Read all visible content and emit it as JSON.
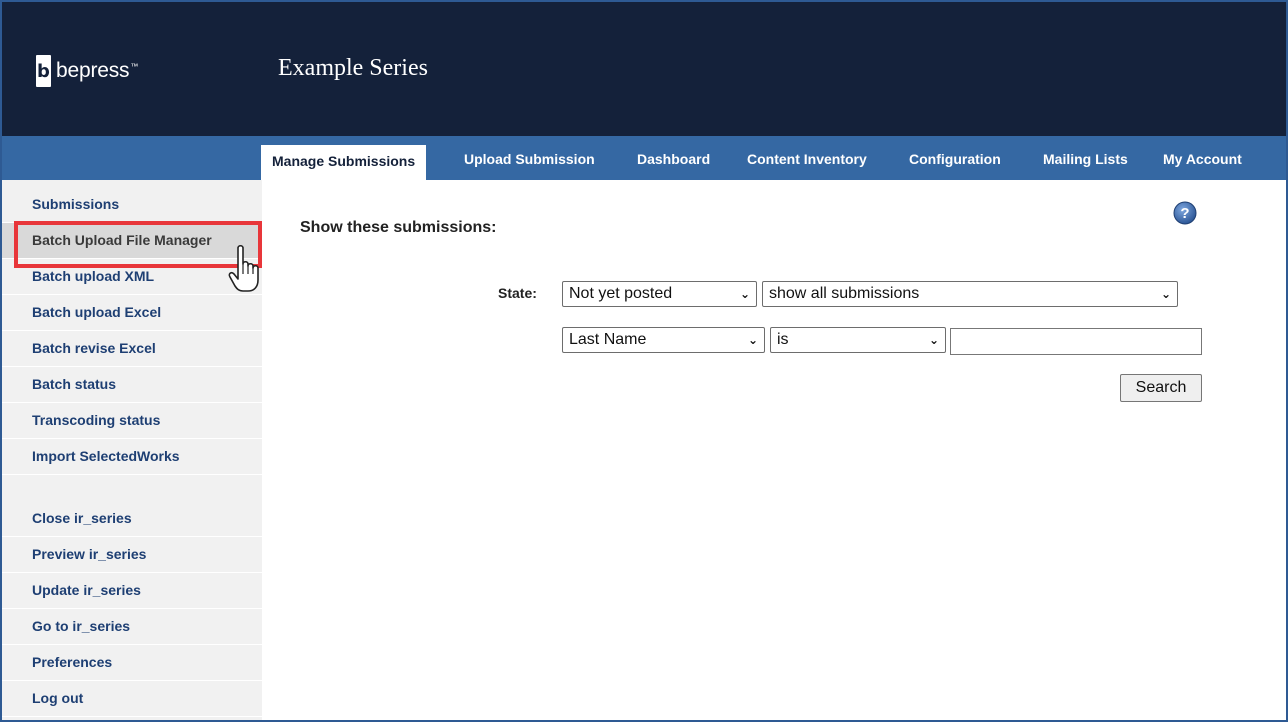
{
  "header": {
    "logo_text": "bepress",
    "logo_tm": "™",
    "logo_glyph": "b",
    "site_title": "Example Series",
    "colors": {
      "header_bg": "#14213a",
      "nav_bg": "#3568a3",
      "highlight_border": "#e8363a"
    }
  },
  "nav": {
    "tabs": [
      {
        "label": "Manage Submissions",
        "active": true
      },
      {
        "label": "Upload Submission"
      },
      {
        "label": "Dashboard"
      },
      {
        "label": "Content Inventory"
      },
      {
        "label": "Configuration"
      },
      {
        "label": "Mailing Lists"
      },
      {
        "label": "My Account"
      }
    ]
  },
  "sidebar": {
    "items": [
      {
        "label": "Submissions"
      },
      {
        "label": "Batch Upload File Manager",
        "highlighted": true
      },
      {
        "label": "Batch upload XML"
      },
      {
        "label": "Batch upload Excel"
      },
      {
        "label": "Batch revise Excel"
      },
      {
        "label": "Batch status"
      },
      {
        "label": "Transcoding status"
      },
      {
        "label": "Import SelectedWorks"
      },
      {
        "label": "Close ir_series"
      },
      {
        "label": "Preview ir_series"
      },
      {
        "label": "Update ir_series"
      },
      {
        "label": "Go to ir_series"
      },
      {
        "label": "Preferences"
      },
      {
        "label": "Log out"
      }
    ]
  },
  "main": {
    "heading": "Show these submissions:",
    "help_icon": "question-circle-icon",
    "state_label": "State:",
    "state_select": "Not yet posted",
    "filter_select": "show all submissions",
    "field_select": "Last Name",
    "operator_select": "is",
    "search_value": "",
    "search_button": "Search",
    "chevron": "⌄"
  }
}
